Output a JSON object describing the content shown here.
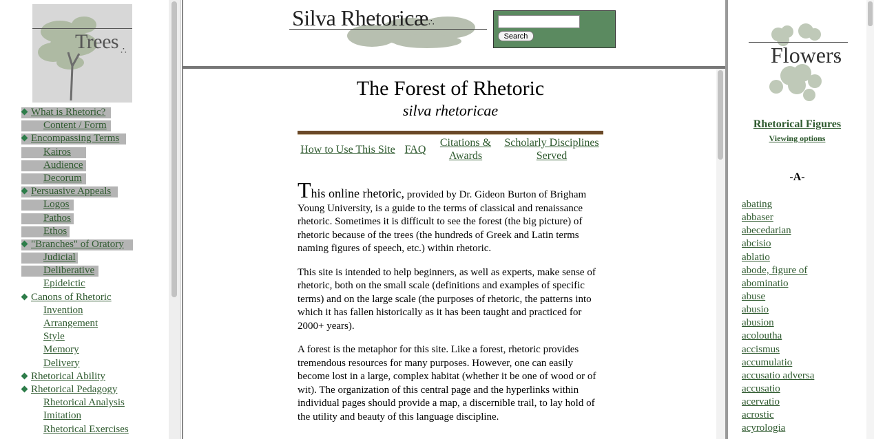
{
  "left_nav": {
    "logo_text": "Trees",
    "logo_dots": "∴",
    "items": [
      {
        "label": "What is Rhetoric?",
        "level": 0,
        "diamond": true,
        "highlight": true,
        "hlw": 130
      },
      {
        "label": "Content / Form",
        "level": 1,
        "diamond": false,
        "highlight": true,
        "hlw": 130
      },
      {
        "label": "Encompassing Terms",
        "level": 0,
        "diamond": true,
        "highlight": true,
        "hlw": 152
      },
      {
        "label": "Kairos",
        "level": 1,
        "diamond": false,
        "highlight": true,
        "hlw": 94
      },
      {
        "label": "Audience",
        "level": 1,
        "diamond": false,
        "highlight": true,
        "hlw": 94
      },
      {
        "label": "Decorum",
        "level": 1,
        "diamond": false,
        "highlight": true,
        "hlw": 94
      },
      {
        "label": "Persuasive Appeals",
        "level": 0,
        "diamond": true,
        "highlight": true,
        "hlw": 140
      },
      {
        "label": "Logos",
        "level": 1,
        "diamond": false,
        "highlight": true,
        "hlw": 76
      },
      {
        "label": "Pathos",
        "level": 1,
        "diamond": false,
        "highlight": true,
        "hlw": 76
      },
      {
        "label": "Ethos",
        "level": 1,
        "diamond": false,
        "highlight": true,
        "hlw": 70
      },
      {
        "label": "\"Branches\" of Oratory",
        "level": 0,
        "diamond": true,
        "highlight": true,
        "hlw": 162
      },
      {
        "label": "Judicial",
        "level": 1,
        "diamond": false,
        "highlight": true,
        "hlw": 82
      },
      {
        "label": "Deliberative",
        "level": 1,
        "diamond": false,
        "highlight": true,
        "hlw": 112
      },
      {
        "label": "Epideictic",
        "level": 1,
        "diamond": false,
        "highlight": false,
        "hlw": 0
      },
      {
        "label": "Canons of Rhetoric",
        "level": 0,
        "diamond": true,
        "highlight": false,
        "hlw": 0
      },
      {
        "label": "Invention",
        "level": 1,
        "diamond": false,
        "highlight": false,
        "hlw": 0
      },
      {
        "label": "Arrangement",
        "level": 1,
        "diamond": false,
        "highlight": false,
        "hlw": 0
      },
      {
        "label": "Style",
        "level": 1,
        "diamond": false,
        "highlight": false,
        "hlw": 0
      },
      {
        "label": "Memory",
        "level": 1,
        "diamond": false,
        "highlight": false,
        "hlw": 0
      },
      {
        "label": "Delivery",
        "level": 1,
        "diamond": false,
        "highlight": false,
        "hlw": 0
      },
      {
        "label": "Rhetorical Ability",
        "level": 0,
        "diamond": true,
        "highlight": false,
        "hlw": 0
      },
      {
        "label": "Rhetorical Pedagogy",
        "level": 0,
        "diamond": true,
        "highlight": false,
        "hlw": 0
      },
      {
        "label": "Rhetorical Analysis",
        "level": 1,
        "diamond": false,
        "highlight": false,
        "hlw": 0
      },
      {
        "label": "Imitation",
        "level": 1,
        "diamond": false,
        "highlight": false,
        "hlw": 0
      },
      {
        "label": "Rhetorical Exercises",
        "level": 1,
        "diamond": false,
        "highlight": false,
        "hlw": 0
      }
    ]
  },
  "header": {
    "site_title": "Silva Rhetoricæ",
    "site_dots": "∴",
    "search": {
      "value": "",
      "button_label": "Search"
    }
  },
  "main": {
    "title": "The Forest of Rhetoric",
    "subtitle": "silva rhetoricae",
    "links": [
      {
        "label": "How to Use This Site"
      },
      {
        "label": "FAQ"
      },
      {
        "label": "Citations & Awards"
      },
      {
        "label": "Scholarly Disciplines Served"
      }
    ],
    "intro": {
      "dropcap": "T",
      "lead": "his online rhetoric,",
      "p1_rest": " provided by Dr. Gideon Burton of Brigham Young University, is a guide to the terms of classical and renaissance rhetoric. Sometimes it is difficult to see the forest (the big picture) of rhetoric because of the trees (the hundreds of Greek and Latin terms naming figures of speech, etc.) within rhetoric.",
      "p2": "This site is intended to help beginners, as well as experts, make sense of rhetoric, both on the small scale (definitions and examples of specific terms) and on the large scale (the purposes of rhetoric, the patterns into which it has fallen historically as it has been taught and practiced for 2000+ years).",
      "p3": "A forest is the metaphor for this site. Like a forest, rhetoric provides tremendous resources for many purposes. However, one can easily become lost in a large, complex habitat (whether it be one of wood or of wit). The organization of this central page and the hyperlinks within individual pages should provide a map, a discernible trail, to lay hold of the utility and beauty of this language discipline."
    }
  },
  "right_nav": {
    "logo_text": "Flowers",
    "logo_dots": "∴",
    "figures_heading": "Rhetorical Figures",
    "viewing_options": "Viewing options",
    "letter_heading": "-A-",
    "terms": [
      "abating",
      "abbaser",
      "abecedarian",
      "abcisio",
      "ablatio",
      "abode, figure of",
      "abominatio",
      "abuse",
      "abusio",
      "abusion",
      "acoloutha",
      "accismus",
      "accumulatio",
      "accusatio adversa",
      "accusatio",
      "acervatio",
      "acrostic",
      "acyrologia"
    ]
  },
  "colors": {
    "link": "#2f5a2f",
    "search_panel": "#5b8a60",
    "nav_highlight": "#b4b4b4",
    "diamond": "#2e7d4a",
    "deco_band": "#6b4a2a"
  }
}
